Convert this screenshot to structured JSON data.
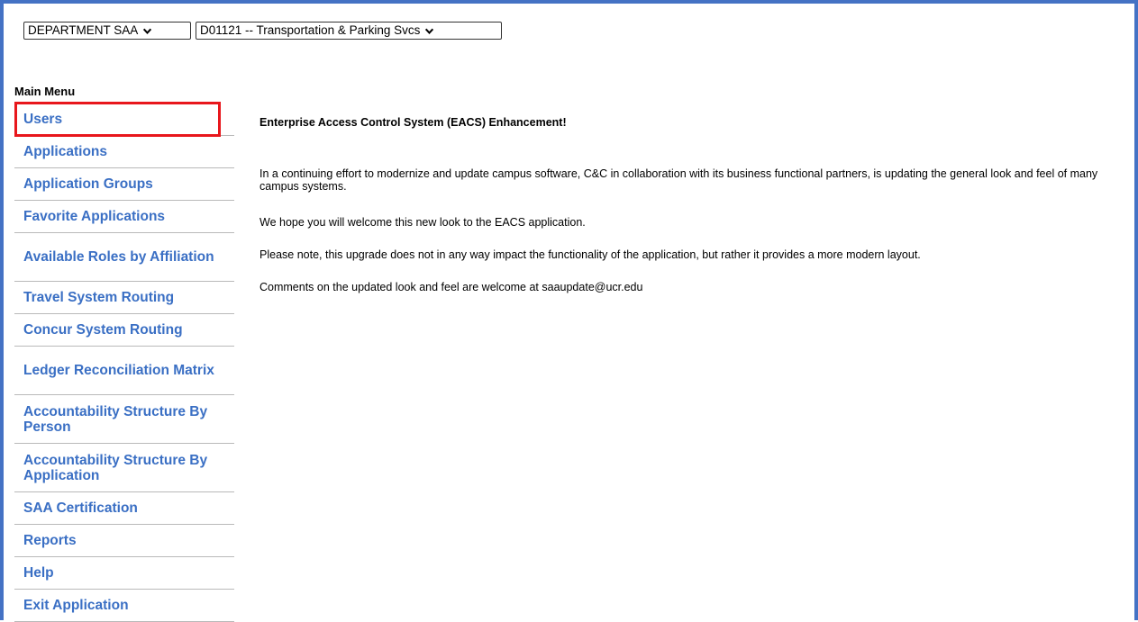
{
  "selects": {
    "role": "DEPARTMENT SAA",
    "department": "D01121 -- Transportation & Parking Svcs"
  },
  "menu": {
    "label": "Main Menu",
    "items": [
      {
        "label": "Users",
        "lines": 1
      },
      {
        "label": "Applications",
        "lines": 1
      },
      {
        "label": "Application Groups",
        "lines": 1
      },
      {
        "label": "Favorite Applications",
        "lines": 1
      },
      {
        "label": "Available Roles by Affiliation",
        "lines": 2
      },
      {
        "label": "Travel System Routing",
        "lines": 1
      },
      {
        "label": "Concur System Routing",
        "lines": 1
      },
      {
        "label": "Ledger Reconciliation Matrix",
        "lines": 2
      },
      {
        "label": "Accountability Structure By Person",
        "lines": 2
      },
      {
        "label": "Accountability Structure By Application",
        "lines": 2
      },
      {
        "label": "SAA Certification",
        "lines": 1
      },
      {
        "label": "Reports",
        "lines": 1
      },
      {
        "label": "Help",
        "lines": 1
      },
      {
        "label": "Exit Application",
        "lines": 1
      }
    ]
  },
  "content": {
    "heading": "Enterprise Access Control System (EACS) Enhancement!",
    "paragraphs": [
      "In a continuing effort to modernize and update campus software, C&C in collaboration with its business functional partners, is updating the general look and feel of many campus systems.",
      "We hope you will welcome this new look to the EACS application.",
      "Please note, this upgrade does not in any way impact the functionality of the application, but rather it provides a more modern layout.",
      "Comments on the updated look and feel are welcome at saaupdate@ucr.edu"
    ]
  },
  "colors": {
    "frame": "#4472c4",
    "menu_link": "#3a6fc4",
    "highlight": "#e8171c"
  }
}
